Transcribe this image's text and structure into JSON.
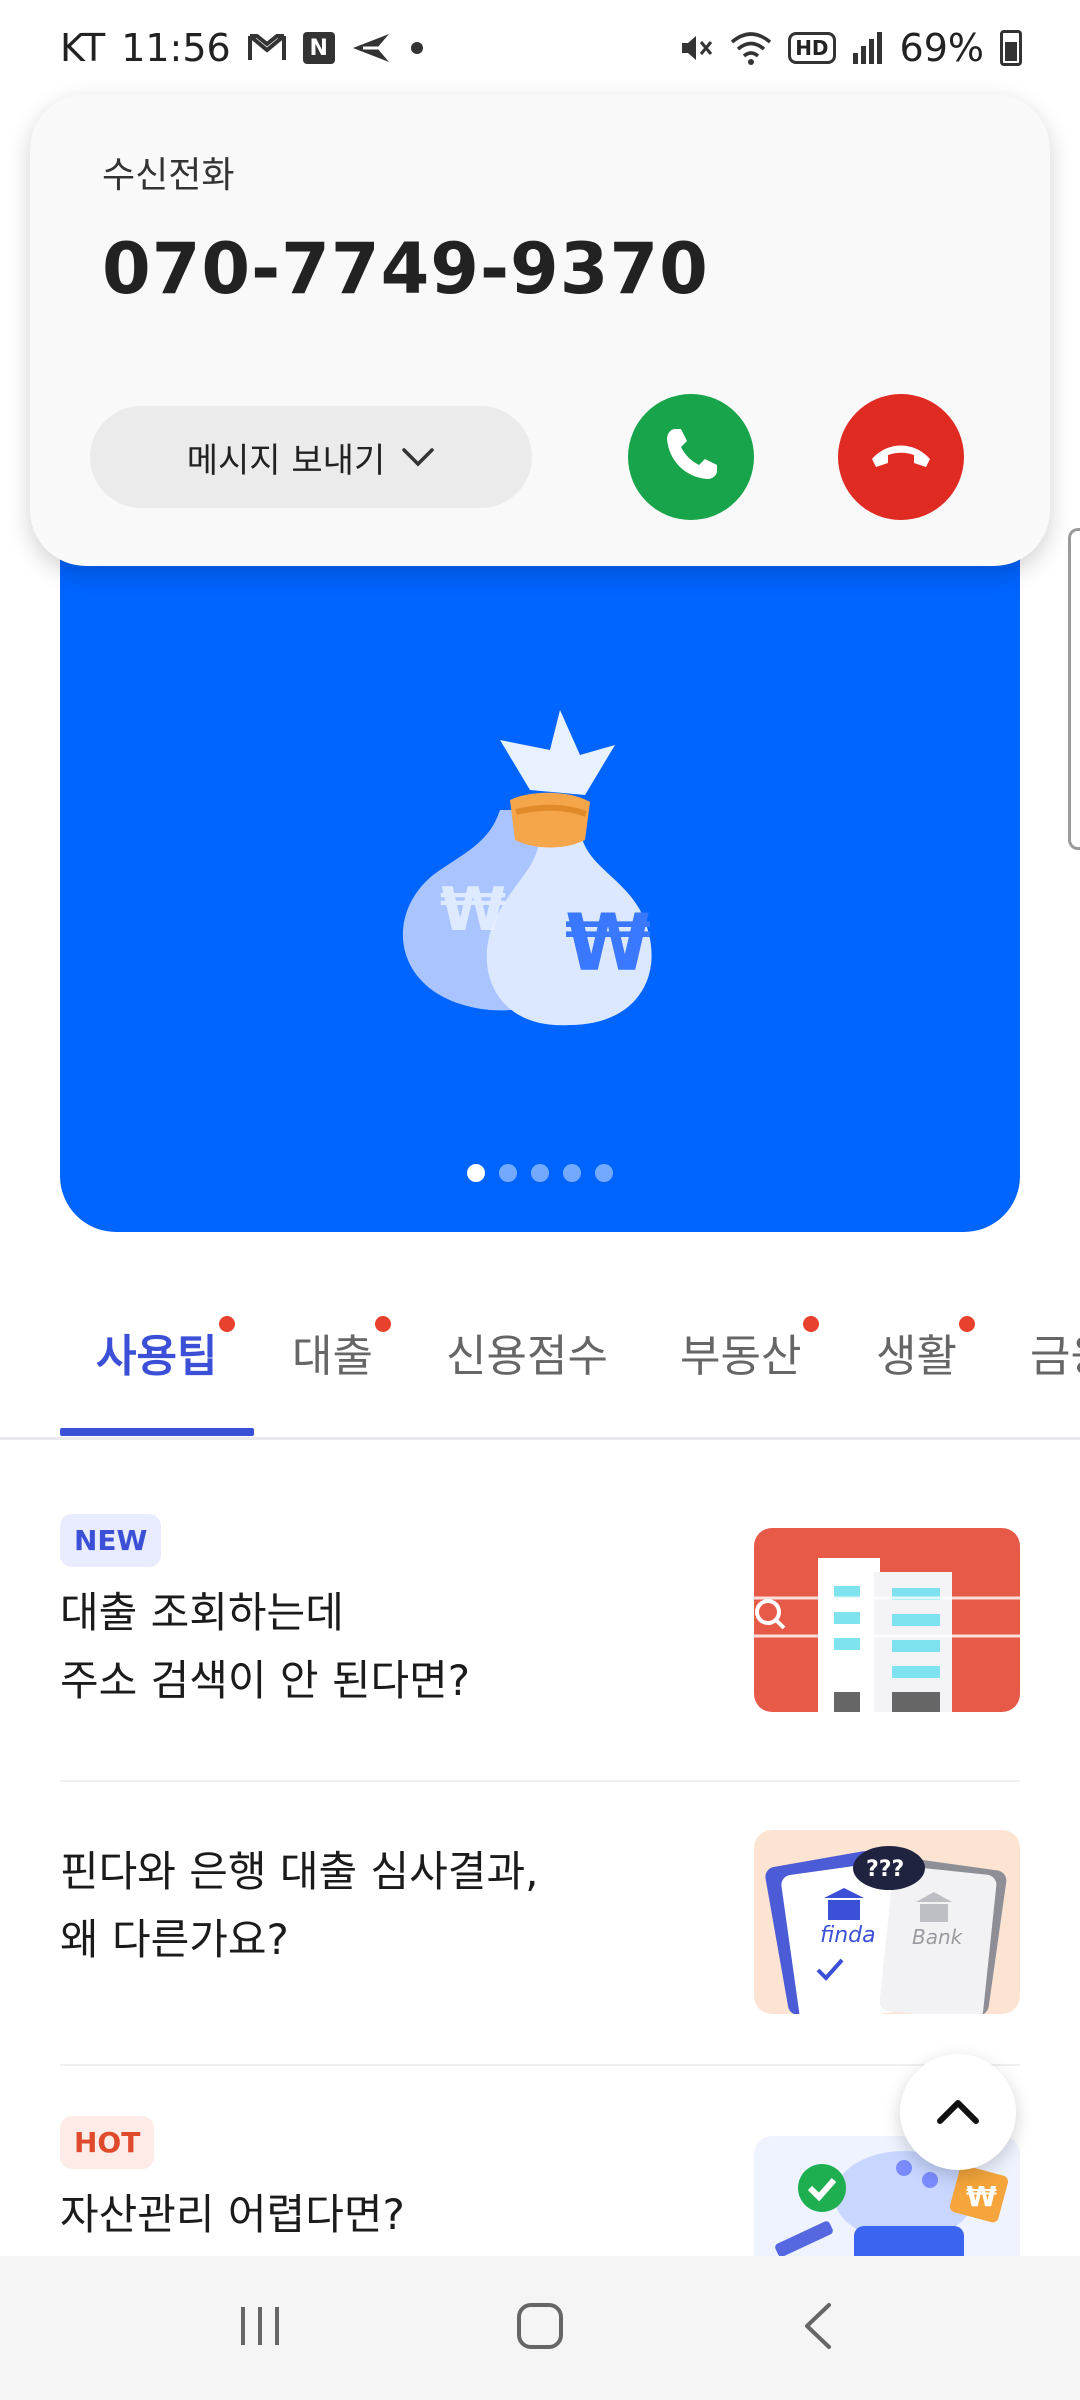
{
  "status_bar": {
    "carrier": "KT",
    "time": "11:56",
    "n_badge": "N",
    "hd_label": "HD",
    "battery": "69%",
    "left_icons": [
      "gmail-icon",
      "naver-icon",
      "send-icon",
      "dot-icon"
    ],
    "right_icons": [
      "mute-icon",
      "wifi-icon",
      "hd-icon",
      "signal-icon",
      "battery-icon"
    ]
  },
  "call": {
    "label": "수신전화",
    "number": "070-7749-9370",
    "message_button": "메시지 보내기",
    "answer_color": "#17a44a",
    "decline_color": "#e02b23"
  },
  "banner": {
    "color": "#0064ff",
    "page_count": 5,
    "active_page": 1
  },
  "tabs": [
    {
      "label": "사용팁",
      "active": true,
      "dot": true
    },
    {
      "label": "대출",
      "active": false,
      "dot": true
    },
    {
      "label": "신용점수",
      "active": false,
      "dot": false
    },
    {
      "label": "부동산",
      "active": false,
      "dot": true
    },
    {
      "label": "생활",
      "active": false,
      "dot": true
    },
    {
      "label": "금융",
      "active": false,
      "dot": false
    }
  ],
  "articles": [
    {
      "badge": "NEW",
      "title": "대출 조회하는데\n주소 검색이 안 된다면?"
    },
    {
      "badge": "",
      "title": "핀다와 은행 대출 심사결과,\n왜 다른가요?"
    },
    {
      "badge": "HOT",
      "title": "자산관리 어렵다면?"
    }
  ],
  "thumbnail_labels": {
    "finda": "finda",
    "bank": "Bank",
    "bubble": "???"
  },
  "colors": {
    "accent": "#3b50d6",
    "red_dot": "#e8422f",
    "hot": "#e04a2c"
  }
}
